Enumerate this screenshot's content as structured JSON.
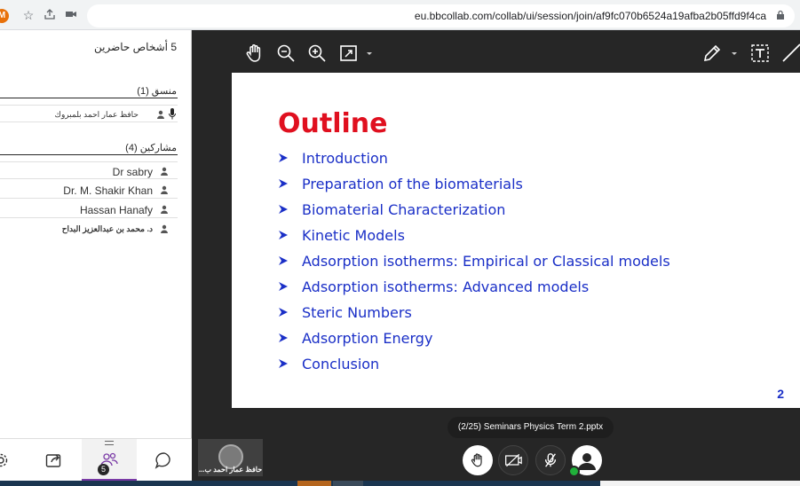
{
  "browser": {
    "profile_initial": "M",
    "url": "eu.bbcollab.com/collab/ui/session/join/af9fc070b6524a19afba2b05ffd9f4ca"
  },
  "sidebar": {
    "header": "5 أشخاص حاضرين",
    "moderator_section": "منسق (1)",
    "moderator_name": "حافظ عمار احمد بلمبروك",
    "participants_section": "مشاركين (4)",
    "participants": [
      {
        "name": "Dr sabry"
      },
      {
        "name": "Dr. M. Shakir Khan"
      },
      {
        "name": "Hassan Hanafy"
      },
      {
        "name": "د. محمد بن عبدالعزيز البداح"
      }
    ],
    "attendee_count": "5"
  },
  "slide": {
    "title": "Outline",
    "bullets": [
      "Introduction",
      "Preparation of the biomaterials",
      "Biomaterial Characterization",
      "Kinetic Models",
      "Adsorption isotherms: Empirical or Classical models",
      "Adsorption isotherms: Advanced models",
      "Steric Numbers",
      "Adsorption Energy",
      "Conclusion"
    ],
    "page_number": "2",
    "title_color": "#e0101f",
    "bullet_color": "#1a2fc7"
  },
  "file_label": "(2/25)  Seminars Physics Term 2.pptx",
  "video_tile": {
    "label": "حافظ عمار احمد ب..."
  },
  "colors": {
    "accent": "#7a3aa6",
    "status_online": "#20b03a"
  }
}
